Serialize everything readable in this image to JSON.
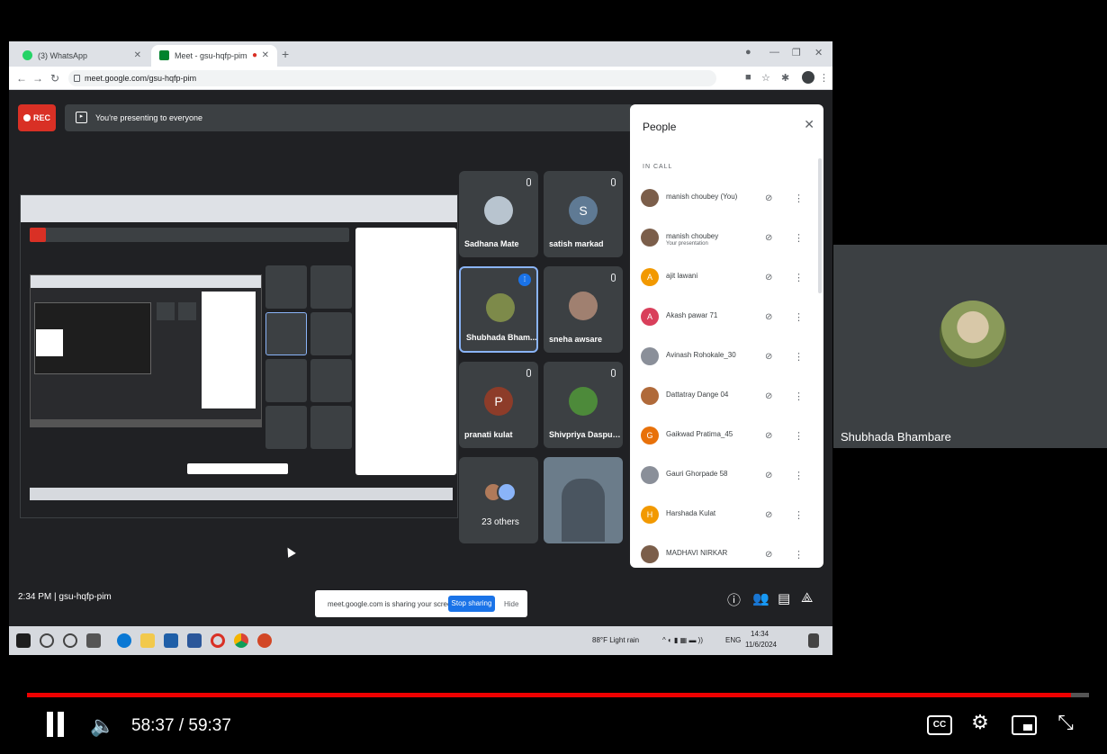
{
  "browser": {
    "tab1_title": "(3) WhatsApp",
    "tab2_title": "Meet - gsu-hqfp-pim",
    "url": "meet.google.com/gsu-hqfp-pim"
  },
  "meet": {
    "rec_label": "REC",
    "presenting_text": "You're presenting to everyone",
    "tiles": [
      {
        "name": "Sadhana Mate",
        "initial": ""
      },
      {
        "name": "satish markad",
        "initial": "S"
      },
      {
        "name": "Shubhada Bham...",
        "initial": ""
      },
      {
        "name": "sneha awsare",
        "initial": ""
      },
      {
        "name": "pranati kulat",
        "initial": "P"
      },
      {
        "name": "Shivpriya Dasput...",
        "initial": ""
      },
      {
        "name": "23 others",
        "initial": ""
      },
      {
        "name": "",
        "initial": ""
      }
    ],
    "people": {
      "title": "People",
      "section": "IN CALL",
      "rows": [
        {
          "name": "manish choubey (You)",
          "sub": "",
          "initial": "",
          "color": "#7b5e4a"
        },
        {
          "name": "manish choubey",
          "sub": "Your presentation",
          "initial": "",
          "color": "#7b5e4a"
        },
        {
          "name": "ajit lawani",
          "sub": "",
          "initial": "A",
          "color": "#f29900"
        },
        {
          "name": "Akash pawar 71",
          "sub": "",
          "initial": "A",
          "color": "#d93f5b"
        },
        {
          "name": "Avinash Rohokale_30",
          "sub": "",
          "initial": "",
          "color": "#8a8f99"
        },
        {
          "name": "Dattatray Dange 04",
          "sub": "",
          "initial": "",
          "color": "#b06a3a"
        },
        {
          "name": "Gaikwad Pratima_45",
          "sub": "",
          "initial": "G",
          "color": "#e8710a"
        },
        {
          "name": "Gauri Ghorpade 58",
          "sub": "",
          "initial": "",
          "color": "#8a8f99"
        },
        {
          "name": "Harshada Kulat",
          "sub": "",
          "initial": "H",
          "color": "#f29900"
        },
        {
          "name": "MADHAVI NIRKAR",
          "sub": "",
          "initial": "",
          "color": "#7b5e4a"
        }
      ]
    },
    "bottom_left": "2:34 PM  |  gsu-hqfp-pim",
    "sharing_text": "meet.google.com is sharing your screen.",
    "stop_sharing": "Stop sharing",
    "hide": "Hide"
  },
  "taskbar": {
    "weather": "88°F  Light rain",
    "lang": "ENG",
    "time": "14:34",
    "date": "11/6/2024"
  },
  "presenter": {
    "name": "Shubhada Bhambare"
  },
  "player": {
    "current_time": "58:37",
    "duration": "59:37",
    "time_display": "58:37 / 59:37",
    "progress": 0.983,
    "accent": "#ee0000"
  }
}
